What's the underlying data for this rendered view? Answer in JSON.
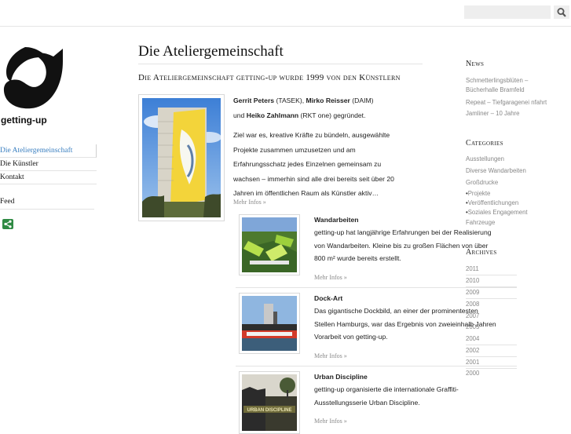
{
  "search": {
    "placeholder": ""
  },
  "logo": {
    "text": "getting-up"
  },
  "leftnav": {
    "items": [
      {
        "label": "Die Ateliergemeinschaft",
        "active": true
      },
      {
        "label": "Die Künstler"
      },
      {
        "label": "Kontakt"
      }
    ],
    "feed": "Feed"
  },
  "main": {
    "title": "Die Ateliergemeinschaft",
    "subtitle": "Die Ateliergemeinschaft getting-up wurde 1999 von den Künstlern",
    "intro": {
      "names": [
        {
          "name": "Gerrit Peters",
          "tag": "(TASEK),"
        },
        {
          "name": "Mirko Reisser",
          "tag": "(DAIM)"
        },
        {
          "name": "Heiko Zahlmann",
          "tag": "(RKT one) gegründet."
        }
      ],
      "and": "und",
      "lines": [
        "Ziel war es, kreative Kräfte zu bündeln, ausgewählte",
        "Projekte zusammen umzusetzen und am",
        "Erfahrungsschatz jedes Einzelnen gemeinsam zu",
        "wachsen – immerhin sind alle drei bereits seit über 20",
        "Jahren im öffentlichen Raum als Künstler aktiv…"
      ],
      "more": "Mehr Infos »"
    },
    "projects": [
      {
        "title": "Wandarbeiten",
        "lines": [
          "getting-up hat langjährige Erfahrungen bei der Realisierung",
          "von Wandarbeiten. Kleine bis zu großen Flächen von über",
          "800 m² wurde bereits erstellt."
        ],
        "more": "Mehr Infos »"
      },
      {
        "title": "Dock-Art",
        "lines": [
          "Das gigantische Dockbild, an einer der prominentesten",
          "Stellen Hamburgs, war das Ergebnis von zweieinhalb Jahren",
          "Vorarbeit von getting-up."
        ],
        "more": "Mehr Infos »"
      },
      {
        "title": "Urban Discipline",
        "lines": [
          "getting-up organisierte die internationale Graffiti-",
          "Ausstellungsserie Urban Discipline."
        ],
        "more": "Mehr Infos »",
        "image_text": "URBAN DISCIPLINE"
      }
    ]
  },
  "sidebar": {
    "news_heading": "News",
    "news": [
      "Schmetterlingsblüten –",
      "Bücherhalle Bramfeld",
      "Repeat – Tiefgaragenei nfahrt",
      "Jamliner – 10 Jahre"
    ],
    "categories_heading": "Categories",
    "categories": [
      "Ausstellungen",
      "Diverse Wandarbeiten",
      "Großdrucke",
      "Projekte",
      "Veröffentlichungen",
      "Soziales Engagement",
      "Fahrzeuge"
    ],
    "archives_heading": "Archives",
    "archives": [
      "2011",
      "2010",
      "2009",
      "2008",
      "2007",
      "2005",
      "2004",
      "2002",
      "2001",
      "2000"
    ]
  },
  "colors": {
    "accent": "#3a7fc0",
    "share": "#2f8a43",
    "muted": "#888888"
  }
}
